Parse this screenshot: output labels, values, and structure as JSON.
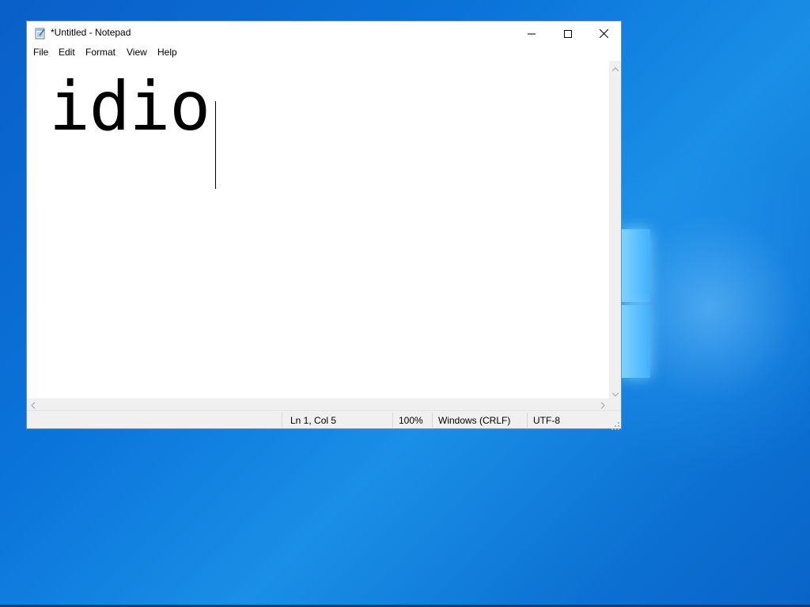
{
  "window": {
    "title": "*Untitled - Notepad",
    "icon": "notepad-icon",
    "caption_buttons": [
      "minimize-icon",
      "maximize-icon",
      "close-icon"
    ]
  },
  "menu": {
    "items": [
      {
        "label": "File"
      },
      {
        "label": "Edit"
      },
      {
        "label": "Format"
      },
      {
        "label": "View"
      },
      {
        "label": "Help"
      }
    ]
  },
  "editor": {
    "text": "idio"
  },
  "status": {
    "position": "Ln 1, Col 5",
    "zoom": "100%",
    "line_ending": "Windows (CRLF)",
    "encoding": "UTF-8"
  },
  "colors": {
    "desktop": "#0a74da",
    "window_border": "#6b8fb5",
    "chrome": "#f0f0f0"
  }
}
